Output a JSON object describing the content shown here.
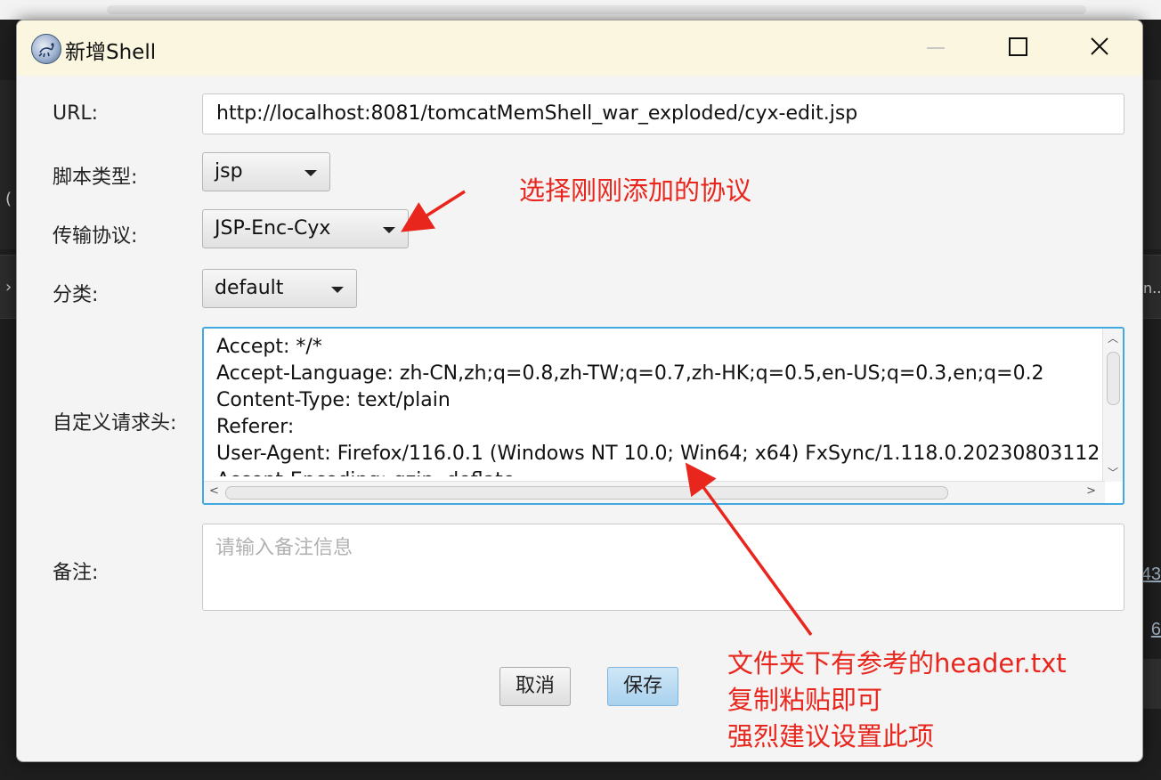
{
  "window": {
    "title": "新增Shell",
    "icon": "scorpion-app-icon",
    "controls": [
      "minimize-icon",
      "maximize-icon",
      "close-icon"
    ]
  },
  "form": {
    "url_label": "URL:",
    "url_value": "http://localhost:8081/tomcatMemShell_war_exploded/cyx-edit.jsp",
    "script_type_label": "脚本类型:",
    "script_type_value": "jsp",
    "protocol_label": "传输协议:",
    "protocol_value": "JSP-Enc-Cyx",
    "category_label": "分类:",
    "category_value": "default",
    "headers_label": "自定义请求头:",
    "headers_lines": [
      "Accept: */*",
      "Accept-Language: zh-CN,zh;q=0.8,zh-TW;q=0.7,zh-HK;q=0.5,en-US;q=0.3,en;q=0.2",
      "Content-Type: text/plain",
      "Referer:",
      "User-Agent: Firefox/116.0.1 (Windows NT 10.0; Win64; x64) FxSync/1.118.0.20230803112",
      "Accept-Encoding: gzip, deflate"
    ],
    "remark_label": "备注:",
    "remark_placeholder": "请输入备注信息"
  },
  "buttons": {
    "cancel_label": "取消",
    "save_label": "保存"
  },
  "annotations": {
    "protocol_note": "选择刚刚添加的协议",
    "header_note_lines": [
      "文件夹下有参考的header.txt",
      "复制粘贴即可",
      "强烈建议设置此项"
    ],
    "color": "#e8261d"
  },
  "background": {
    "edge_numbers": [
      "43",
      "6"
    ],
    "edge_text": "n..."
  }
}
